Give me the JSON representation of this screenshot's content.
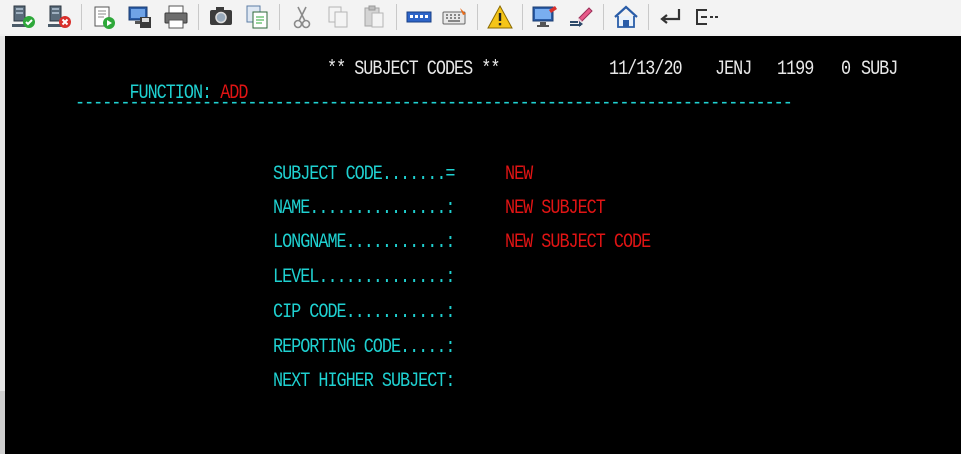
{
  "toolbar": {
    "buttons": [
      {
        "name": "connect-icon"
      },
      {
        "name": "disconnect-icon"
      },
      {
        "name": "run-script-icon"
      },
      {
        "name": "save-screen-icon"
      },
      {
        "name": "print-icon"
      },
      {
        "name": "capture-icon"
      },
      {
        "name": "copy-screen-icon"
      },
      {
        "name": "cut-icon"
      },
      {
        "name": "copy-icon"
      },
      {
        "name": "paste-icon"
      },
      {
        "name": "keypad-icon"
      },
      {
        "name": "keyboard-map-icon"
      },
      {
        "name": "warning-icon"
      },
      {
        "name": "display-settings-icon"
      },
      {
        "name": "transfer-icon"
      },
      {
        "name": "home-icon"
      },
      {
        "name": "enter-icon"
      },
      {
        "name": "field-exit-icon"
      }
    ]
  },
  "screen": {
    "function_label": "FUNCTION:",
    "function_value": "ADD",
    "title": "** SUBJECT CODES **",
    "date": "11/13/20",
    "user": "JENJ",
    "term": "1199",
    "count": "0",
    "screen_code": "SUBJ",
    "divider": "-------------------------------------------------------------------------------",
    "fields": [
      {
        "label": "SUBJECT CODE.......=",
        "value": "NEW"
      },
      {
        "label": "NAME...............:",
        "value": "NEW SUBJECT"
      },
      {
        "label": "LONGNAME...........:",
        "value": "NEW SUBJECT CODE"
      },
      {
        "label": "LEVEL..............:",
        "value": ""
      },
      {
        "label": "CIP CODE...........:",
        "value": ""
      },
      {
        "label": "REPORTING CODE.....:",
        "value": ""
      },
      {
        "label": "NEXT HIGHER SUBJECT:",
        "value": ""
      }
    ]
  },
  "colors": {
    "label": "#1fd1d1",
    "value": "#e01414",
    "text": "#e8e8e8",
    "background": "#000000"
  }
}
